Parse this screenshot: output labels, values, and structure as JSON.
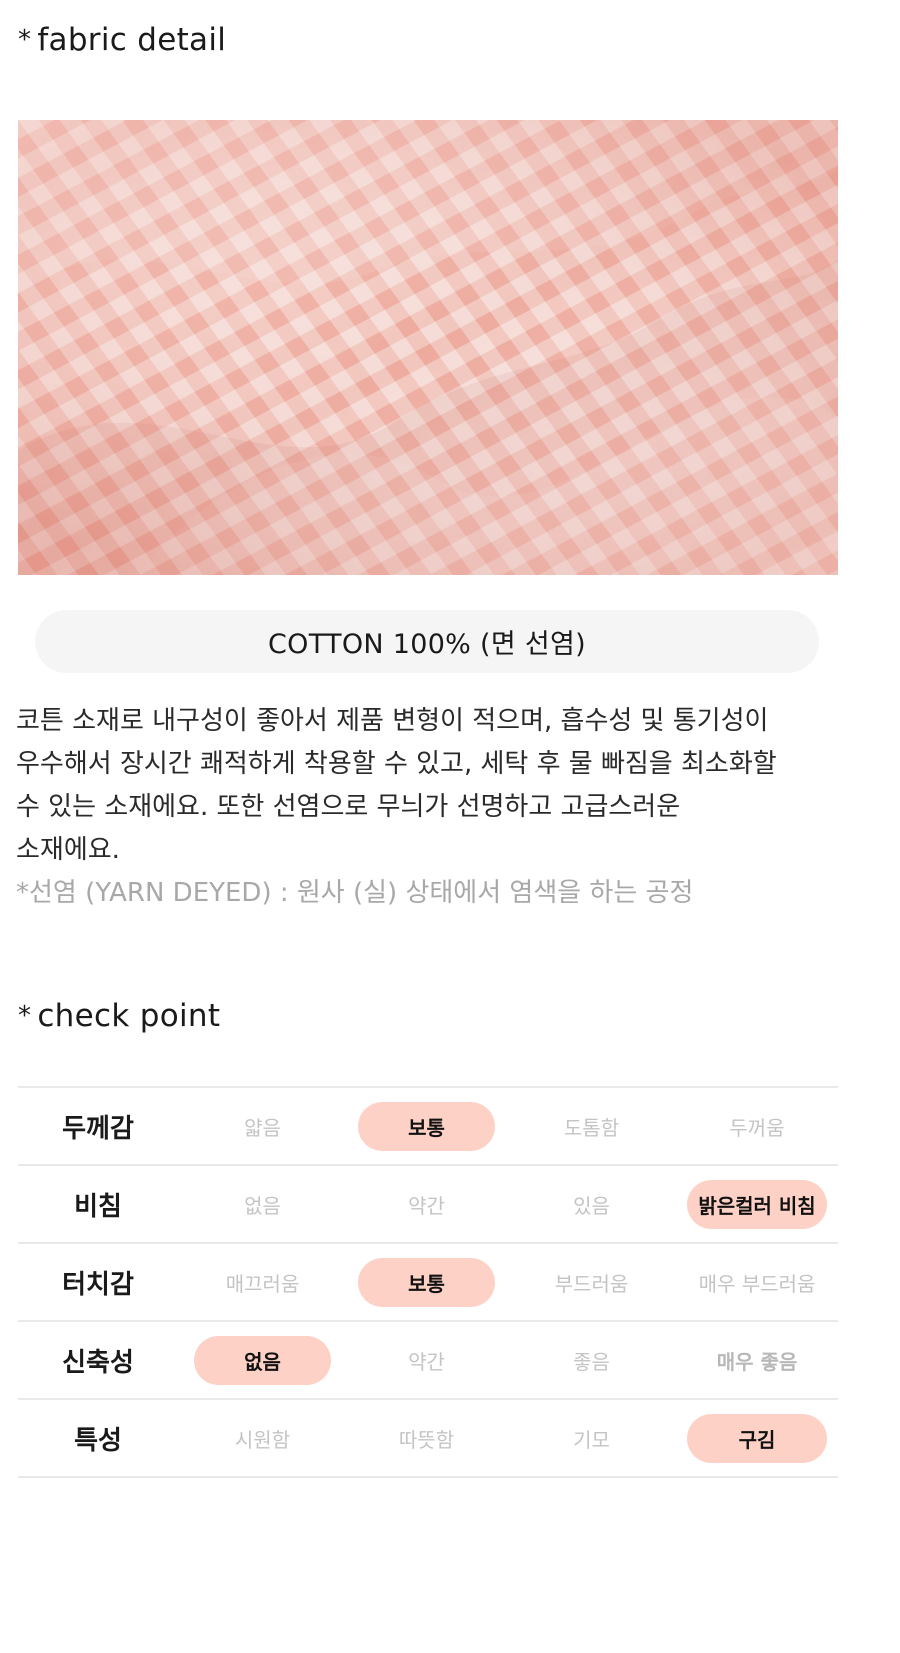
{
  "fabric_section": {
    "star": "*",
    "title": "fabric detail",
    "image_alt": "pink gingham cotton fabric close-up",
    "composition": "COTTON 100% (면 선염)",
    "description_lines": [
      "코튼 소재로 내구성이 좋아서 제품 변형이 적으며, 흡수성 및 통기성이",
      "우수해서 장시간 쾌적하게 착용할 수 있고, 세탁 후 물 빠짐을 최소화할",
      "수 있는 소재에요. 또한 선염으로 무늬가 선명하고 고급스러운",
      "소재에요."
    ],
    "note": "*선염 (YARN DEYED) : 원사 (실) 상태에서 염색을 하는 공정"
  },
  "check_section": {
    "star": "*",
    "title": "check point",
    "rows": [
      {
        "label": "두께감",
        "options": [
          "얇음",
          "보통",
          "도톰함",
          "두꺼움"
        ],
        "selected": 1
      },
      {
        "label": "비침",
        "options": [
          "없음",
          "약간",
          "있음",
          "밝은컬러 비침"
        ],
        "selected": 3
      },
      {
        "label": "터치감",
        "options": [
          "매끄러움",
          "보통",
          "부드러움",
          "매우 부드러움"
        ],
        "selected": 1
      },
      {
        "label": "신축성",
        "options": [
          "없음",
          "약간",
          "좋음",
          "매우 좋음"
        ],
        "selected": 0
      },
      {
        "label": "특성",
        "options": [
          "시원함",
          "따뜻함",
          "기모",
          "구김"
        ],
        "selected": 3
      }
    ]
  },
  "colors": {
    "highlight": "#fdd1c6",
    "muted_text": "#c4c4c4",
    "pill_bg": "#f5f5f5"
  }
}
